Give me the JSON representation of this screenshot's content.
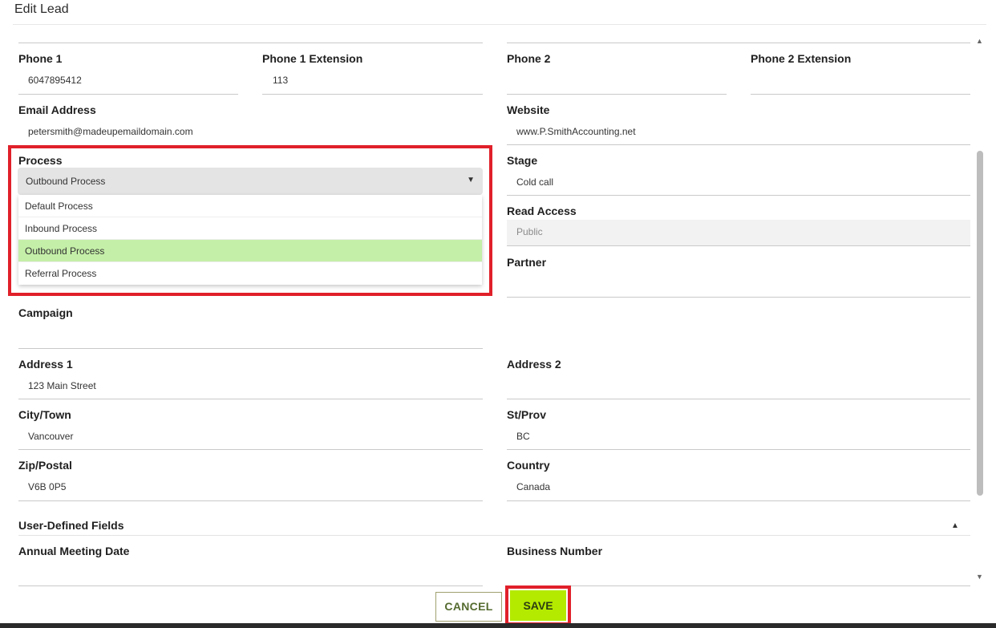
{
  "dialog": {
    "title": "Edit Lead"
  },
  "fields": {
    "phone1": {
      "label": "Phone 1",
      "value": "6047895412"
    },
    "phone1_ext": {
      "label": "Phone 1 Extension",
      "value": "113"
    },
    "phone2": {
      "label": "Phone 2",
      "value": ""
    },
    "phone2_ext": {
      "label": "Phone 2 Extension",
      "value": ""
    },
    "email": {
      "label": "Email Address",
      "value": "petersmith@madeupemaildomain.com"
    },
    "website": {
      "label": "Website",
      "value": "www.P.SmithAccounting.net"
    },
    "process": {
      "label": "Process",
      "value": "Outbound Process",
      "options": [
        "Default Process",
        "Inbound Process",
        "Outbound Process",
        "Referral Process"
      ],
      "selected_index": 2
    },
    "stage": {
      "label": "Stage",
      "value": "Cold call"
    },
    "read_access": {
      "label": "Read Access",
      "value": "Public"
    },
    "partner": {
      "label": "Partner",
      "value": ""
    },
    "campaign": {
      "label": "Campaign",
      "value": ""
    },
    "address1": {
      "label": "Address 1",
      "value": "123 Main Street"
    },
    "address2": {
      "label": "Address 2",
      "value": ""
    },
    "city": {
      "label": "City/Town",
      "value": "Vancouver"
    },
    "state": {
      "label": "St/Prov",
      "value": "BC"
    },
    "zip": {
      "label": "Zip/Postal",
      "value": "V6B 0P5"
    },
    "country": {
      "label": "Country",
      "value": "Canada"
    }
  },
  "user_defined": {
    "header": "User-Defined Fields",
    "annual_meeting_date": {
      "label": "Annual Meeting Date",
      "value": ""
    },
    "business_number": {
      "label": "Business Number",
      "value": ""
    }
  },
  "actions": {
    "cancel_label": "CANCEL",
    "save_label": "SAVE"
  },
  "icons": {
    "dropdown_caret": "caret-down-icon",
    "collapse": "caret-up-icon",
    "scroll_up": "scroll-up-icon",
    "scroll_down": "scroll-down-icon"
  },
  "colors": {
    "highlight": "#e0202a",
    "save_button": "#b4ea00",
    "selected_option": "#c4efa8"
  }
}
